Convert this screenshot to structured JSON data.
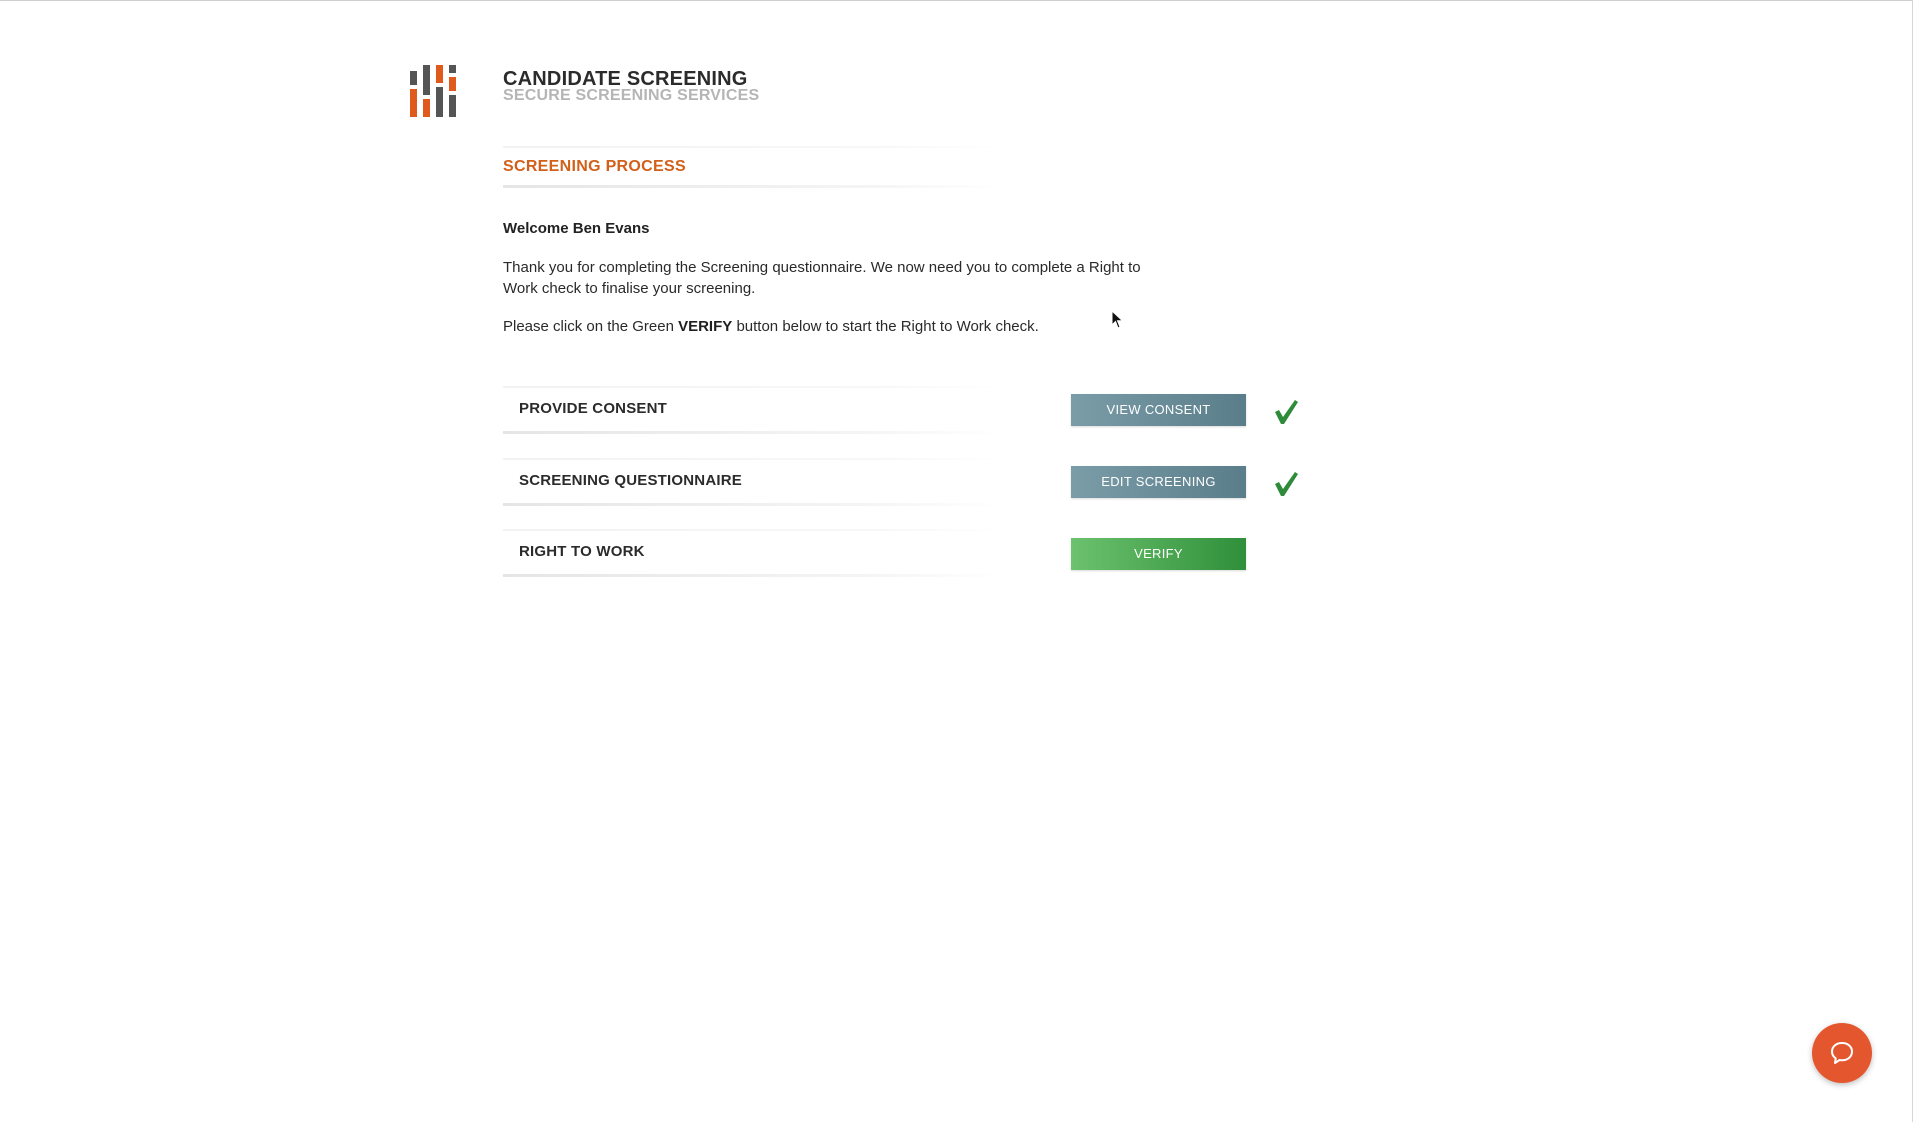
{
  "header": {
    "logo_icon": "bar-grid-logo-icon",
    "title": "CANDIDATE SCREENING",
    "subtitle": "SECURE SCREENING SERVICES"
  },
  "section": {
    "title": "SCREENING PROCESS"
  },
  "content": {
    "welcome": "Welcome Ben Evans",
    "intro": "Thank you for completing the Screening questionnaire. We now need you to complete a Right to Work check to finalise your screening.",
    "instruction_before": "Please click on the Green ",
    "instruction_bold": "VERIFY",
    "instruction_after": " button below to start the Right to Work check."
  },
  "steps": [
    {
      "label": "PROVIDE CONSENT",
      "button": "VIEW CONSENT",
      "completed": true
    },
    {
      "label": "SCREENING QUESTIONNAIRE",
      "button": "EDIT SCREENING",
      "completed": true
    },
    {
      "label": "RIGHT TO WORK",
      "button": "VERIFY",
      "completed": false
    }
  ],
  "colors": {
    "accent": "#d2601a",
    "check": "#2e8b3a",
    "button_grey": "#5a7d8a",
    "button_green": "#3a9a44",
    "help_bubble": "#e4572e"
  },
  "help": {
    "icon": "chat-bubble-icon"
  }
}
